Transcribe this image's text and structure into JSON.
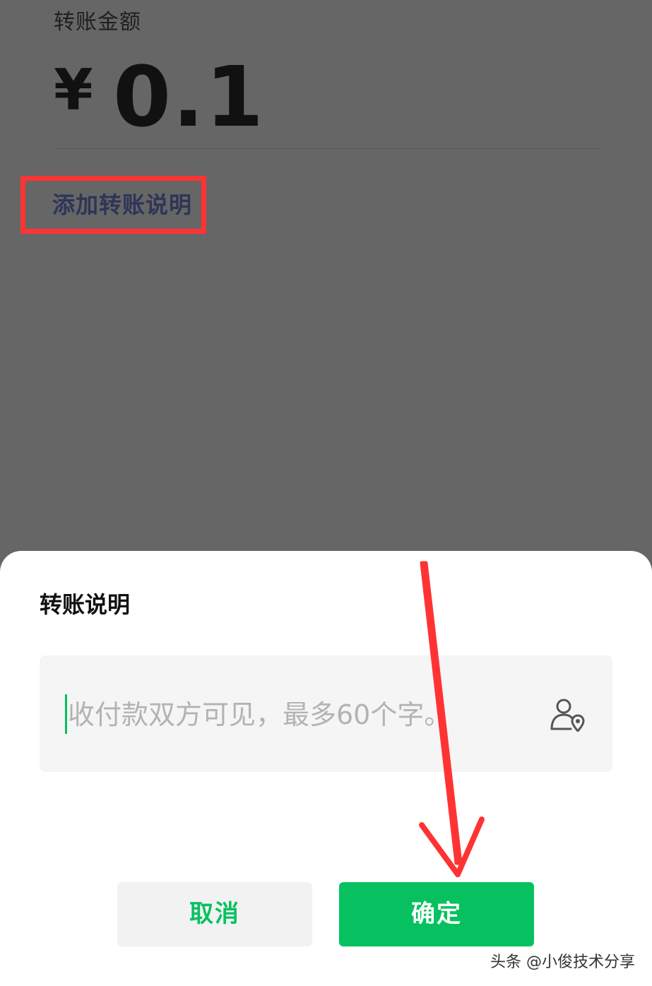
{
  "background_page": {
    "amount_label": "转账金额",
    "currency_symbol": "¥",
    "amount": "0.1",
    "add_note_link": "添加转账说明"
  },
  "sheet": {
    "title": "转账说明",
    "input": {
      "placeholder": "收付款双方可见，最多60个字。",
      "value": ""
    },
    "contact_icon": "contact-location-icon",
    "cancel_label": "取消",
    "confirm_label": "确定"
  },
  "annotations": {
    "highlight_color": "#ff3333",
    "arrow_color": "#ff3333"
  },
  "watermark": "头条 @小俊技术分享",
  "colors": {
    "accent_green": "#07c160",
    "overlay_gray": "#666666"
  }
}
